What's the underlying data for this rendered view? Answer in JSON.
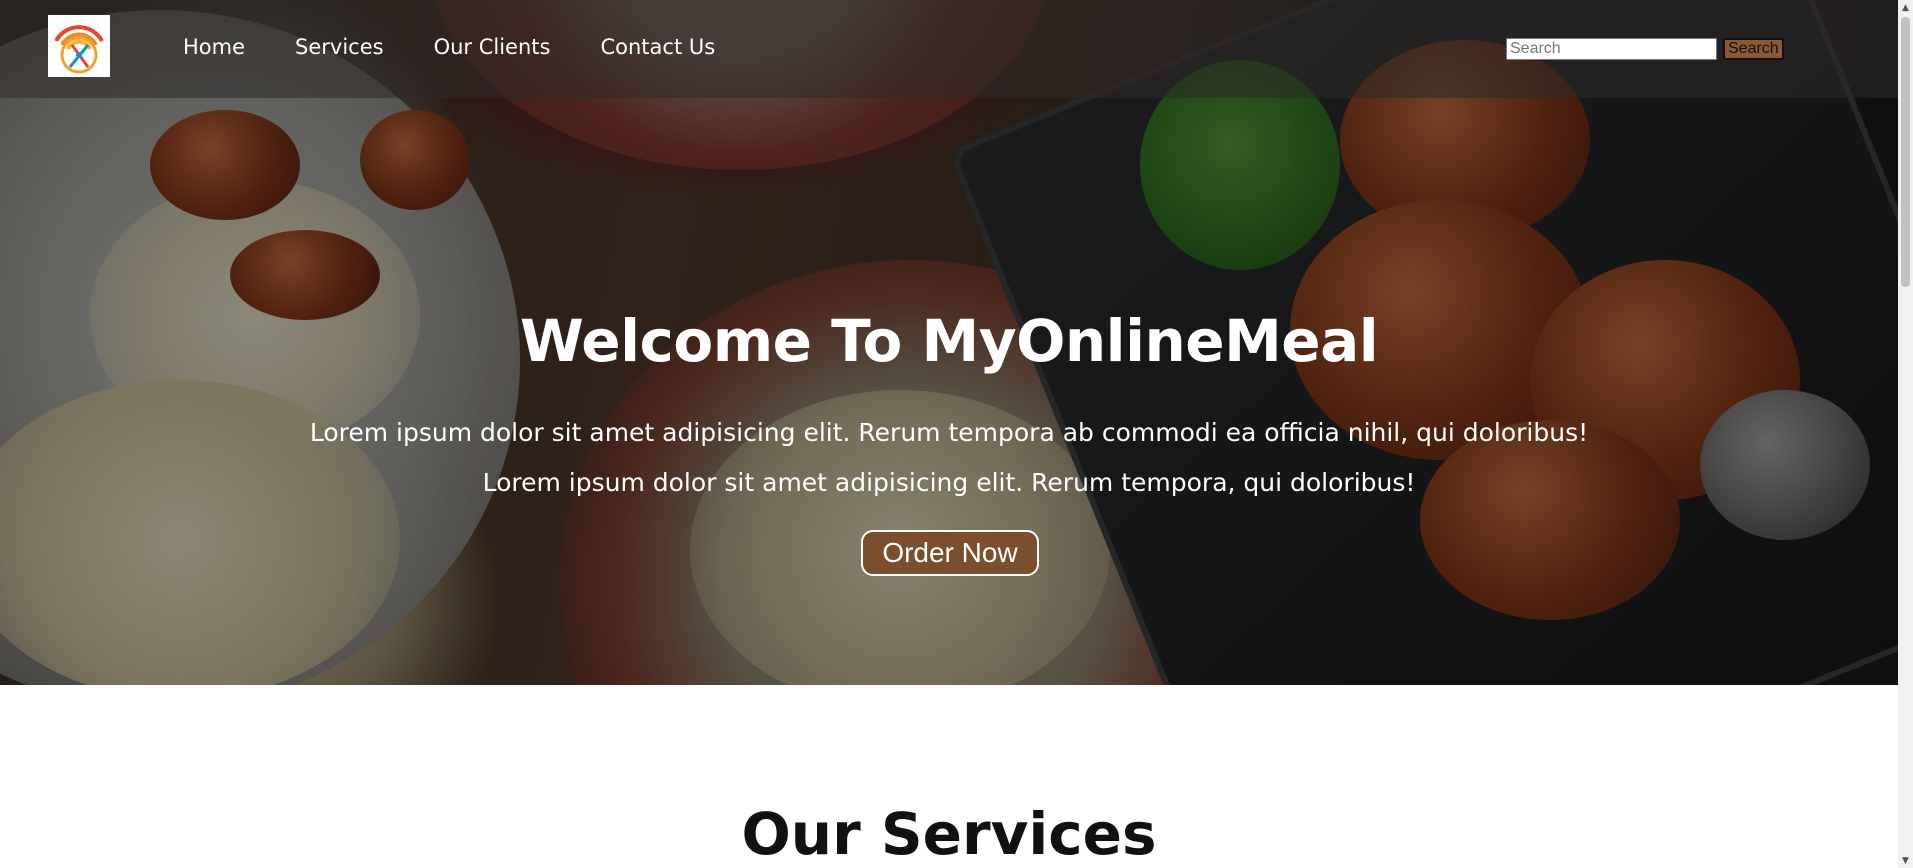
{
  "nav": {
    "logo_icon": "wifi-fork-spoon-logo-icon",
    "links": [
      {
        "label": "Home"
      },
      {
        "label": "Services"
      },
      {
        "label": "Our Clients"
      },
      {
        "label": "Contact Us"
      }
    ],
    "search": {
      "placeholder": "Search",
      "button_label": "Search"
    }
  },
  "hero": {
    "title": "Welcome To MyOnlineMeal",
    "line1": "Lorem ipsum dolor sit amet adipisicing elit. Rerum tempora ab commodi ea officia nihil, qui doloribus!",
    "line2": "Lorem ipsum dolor sit amet adipisicing elit. Rerum tempora, qui doloribus!",
    "cta_label": "Order Now",
    "background": "food-photo-image"
  },
  "services": {
    "title": "Our Services"
  },
  "colors": {
    "accent_brown": "#7b4f2e",
    "nav_overlay": "rgba(45,42,40,0.55)",
    "text_light": "#ffffff",
    "text_dark": "#111111"
  }
}
